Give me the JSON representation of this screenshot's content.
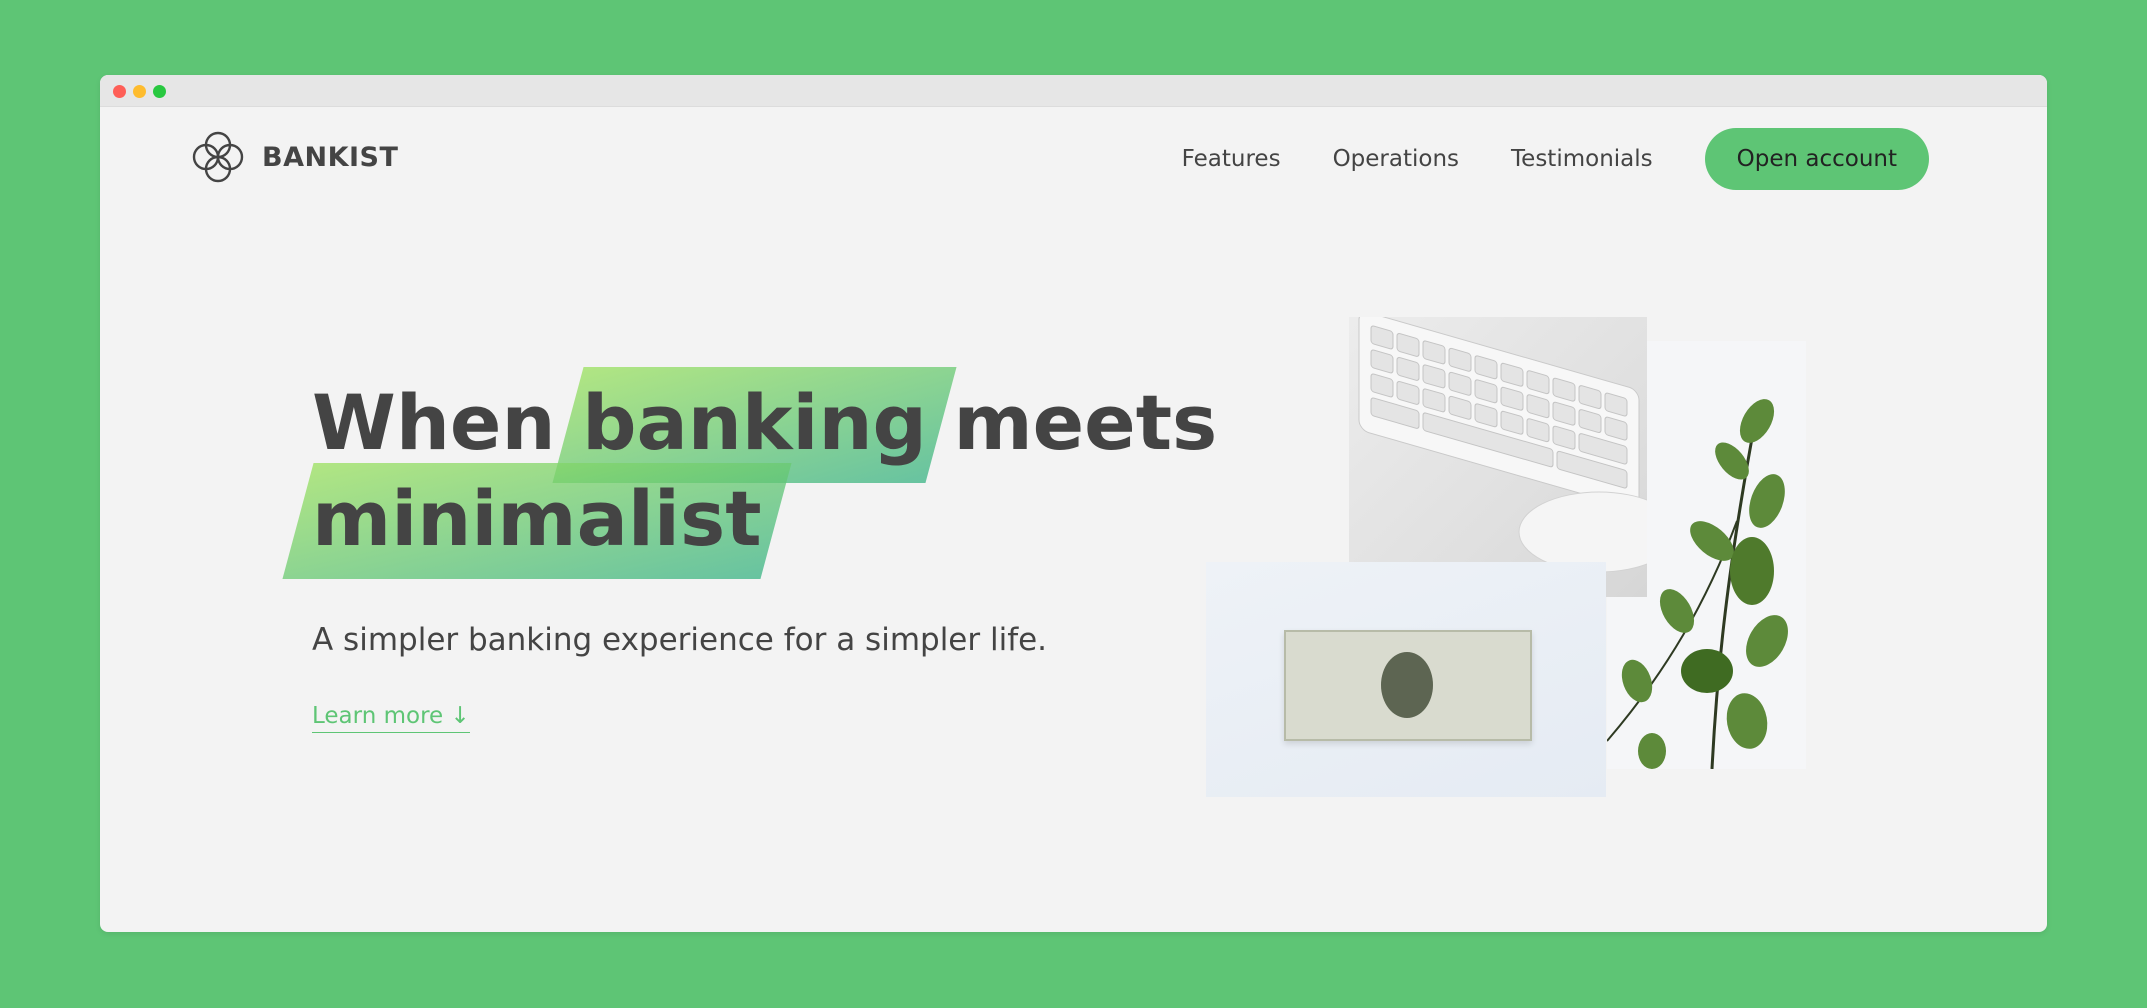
{
  "window": {
    "controls": [
      "close",
      "minimize",
      "maximize"
    ]
  },
  "brand": {
    "name": "BANKIST",
    "logo_icon": "four-circles-logo-icon"
  },
  "nav": {
    "links": [
      "Features",
      "Operations",
      "Testimonials"
    ],
    "cta": "Open account"
  },
  "hero": {
    "title": {
      "line1": [
        "When",
        "banking",
        "meets"
      ],
      "line2": "minimalist"
    },
    "subtitle": "A simpler banking experience for a simpler life.",
    "learn_more": "Learn more ↓"
  },
  "colors": {
    "background": "#5ec575",
    "accent": "#5ec575",
    "highlight_gradient": [
      "#9be15d",
      "#39b385"
    ],
    "text": "#444444",
    "page": "#f3f3f3"
  }
}
